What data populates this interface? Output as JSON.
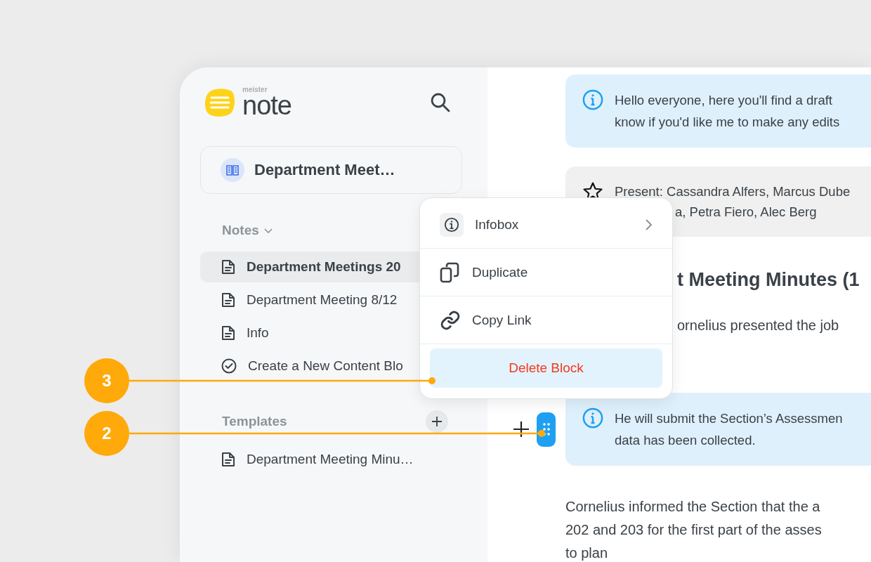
{
  "brand": {
    "small": "meister",
    "name": "note"
  },
  "notebook": {
    "title": "Department Meet…"
  },
  "notes_section": {
    "label": "Notes",
    "expanded": true
  },
  "notes": [
    {
      "title": "Department Meetings 20",
      "kind": "page",
      "selected": true
    },
    {
      "title": "Department Meeting 8/12",
      "kind": "page",
      "selected": false
    },
    {
      "title": "Info",
      "kind": "page",
      "selected": false
    },
    {
      "title": "Create a New Content Blo",
      "kind": "task",
      "selected": false
    }
  ],
  "templates_section": {
    "label": "Templates"
  },
  "templates": [
    {
      "title": "Department Meeting Minu…",
      "kind": "page",
      "selected": false
    }
  ],
  "blocks": [
    {
      "kind": "info",
      "hovered": false,
      "lines": [
        "Hello everyone, here you'll find a draft",
        "know if you'd like me to make any edits"
      ]
    },
    {
      "kind": "callout",
      "hovered": false,
      "lines": [
        "Present: Cassandra Alfers, Marcus Dube",
        "a, Petra Fiero, Alec Berg"
      ]
    },
    {
      "kind": "heading",
      "hovered": false,
      "lines": [
        "t Meeting Minutes (1"
      ]
    },
    {
      "kind": "paragraph",
      "hovered": false,
      "lines": [
        "ornelius presented the job"
      ]
    },
    {
      "kind": "info",
      "hovered": true,
      "lines": [
        "He will submit the Section’s Assessmen",
        "data has been collected."
      ]
    },
    {
      "kind": "paragraph",
      "hovered": false,
      "lines": [
        "Cornelius informed the Section that the a",
        "202 and 203 for the first part of the asses",
        "to plan"
      ]
    }
  ],
  "menu": [
    {
      "label": "Infobox",
      "kind": "submenu",
      "selected": false
    },
    {
      "label": "Duplicate",
      "kind": "duplicate",
      "selected": false
    },
    {
      "label": "Copy Link",
      "kind": "link",
      "selected": false
    },
    {
      "label": "Delete Block",
      "kind": "danger",
      "selected": true
    }
  ],
  "annotations": [
    {
      "label": "3"
    },
    {
      "label": "2"
    }
  ]
}
